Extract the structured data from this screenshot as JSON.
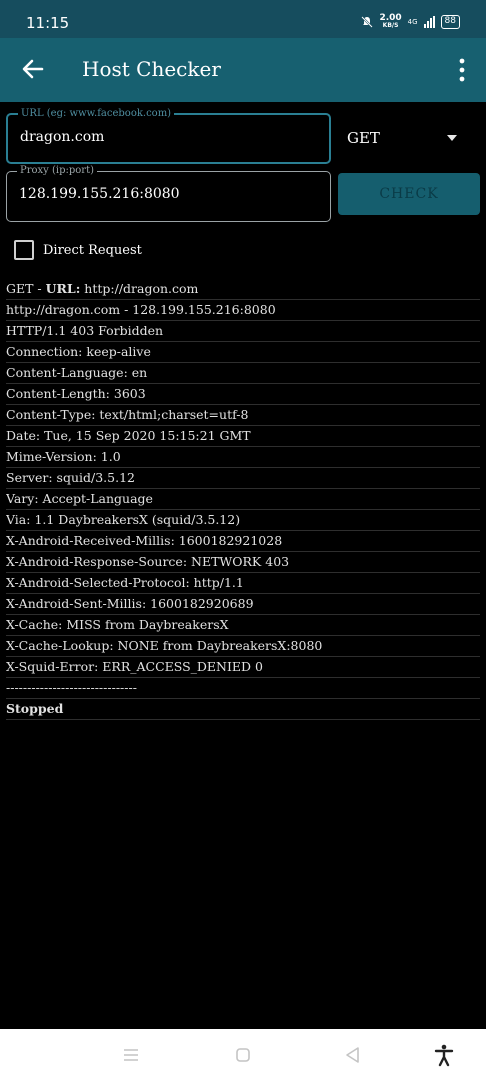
{
  "status_bar": {
    "time": "11:15",
    "speed_value": "2.00",
    "speed_unit": "KB/S",
    "network": "4G",
    "battery": "88"
  },
  "app_bar": {
    "title": "Host Checker",
    "back_icon": "arrow-left-icon",
    "menu_icon": "more-vertical-icon"
  },
  "form": {
    "url_label": "URL (eg: www.facebook.com)",
    "url_value": "dragon.com",
    "proxy_label": "Proxy (ip:port)",
    "proxy_value": "128.199.155.216:8080",
    "method": "GET",
    "check_label": "CHECK",
    "direct_label": "Direct Request",
    "direct_checked": false
  },
  "log": {
    "first_prefix": "GET - ",
    "first_bold": "URL:",
    "first_rest": " http://dragon.com",
    "lines": [
      "http://dragon.com - 128.199.155.216:8080",
      "HTTP/1.1 403 Forbidden",
      "Connection: keep-alive",
      "Content-Language: en",
      "Content-Length: 3603",
      "Content-Type: text/html;charset=utf-8",
      "Date: Tue, 15 Sep 2020 15:15:21 GMT",
      "Mime-Version: 1.0",
      "Server: squid/3.5.12",
      "Vary: Accept-Language",
      "Via: 1.1 DaybreakersX (squid/3.5.12)",
      "X-Android-Received-Millis: 1600182921028",
      "X-Android-Response-Source: NETWORK 403",
      "X-Android-Selected-Protocol: http/1.1",
      "X-Android-Sent-Millis: 1600182920689",
      "X-Cache: MISS from DaybreakersX",
      "X-Cache-Lookup: NONE from DaybreakersX:8080",
      "X-Squid-Error: ERR_ACCESS_DENIED 0",
      "-------------------------------",
      "Stopped"
    ]
  },
  "colors": {
    "app_bar": "#176070",
    "status_bar": "#164d5e",
    "button": "#155e6e",
    "focus_border": "#2a7f93"
  }
}
